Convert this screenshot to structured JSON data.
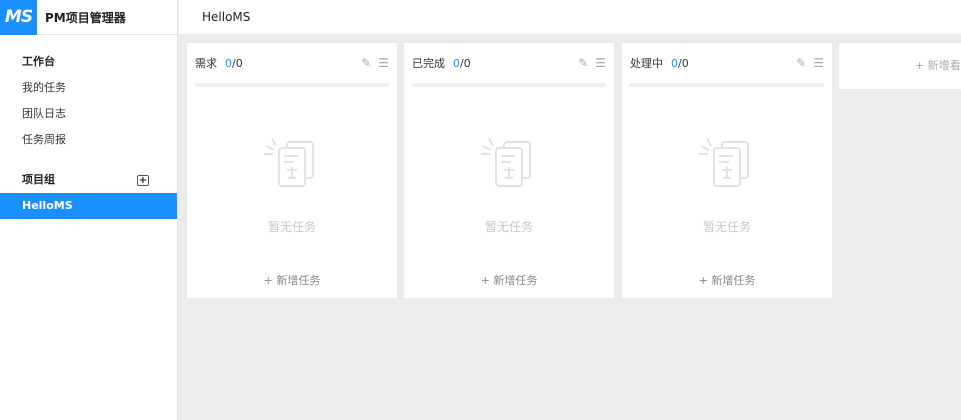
{
  "app": {
    "logo": "MS",
    "title": "PM项目管理器"
  },
  "sidebar": {
    "workspace_heading": "工作台",
    "items": [
      {
        "label": "我的任务"
      },
      {
        "label": "团队日志"
      },
      {
        "label": "任务周报"
      }
    ],
    "groups_heading": "项目组",
    "projects": [
      {
        "label": "HelloMS",
        "active": true
      }
    ]
  },
  "header": {
    "title": "HelloMS"
  },
  "columns": [
    {
      "title": "需求",
      "done": "0",
      "total": "/0",
      "empty_text": "暂无任务",
      "add_label": "+ 新增任务"
    },
    {
      "title": "已完成",
      "done": "0",
      "total": "/0",
      "empty_text": "暂无任务",
      "add_label": "+ 新增任务"
    },
    {
      "title": "处理中",
      "done": "0",
      "total": "/0",
      "empty_text": "暂无任务",
      "add_label": "+ 新增任务"
    }
  ],
  "add_board_label": "+ 新增看板",
  "colors": {
    "accent": "#1890ff",
    "background": "#ebebeb"
  }
}
